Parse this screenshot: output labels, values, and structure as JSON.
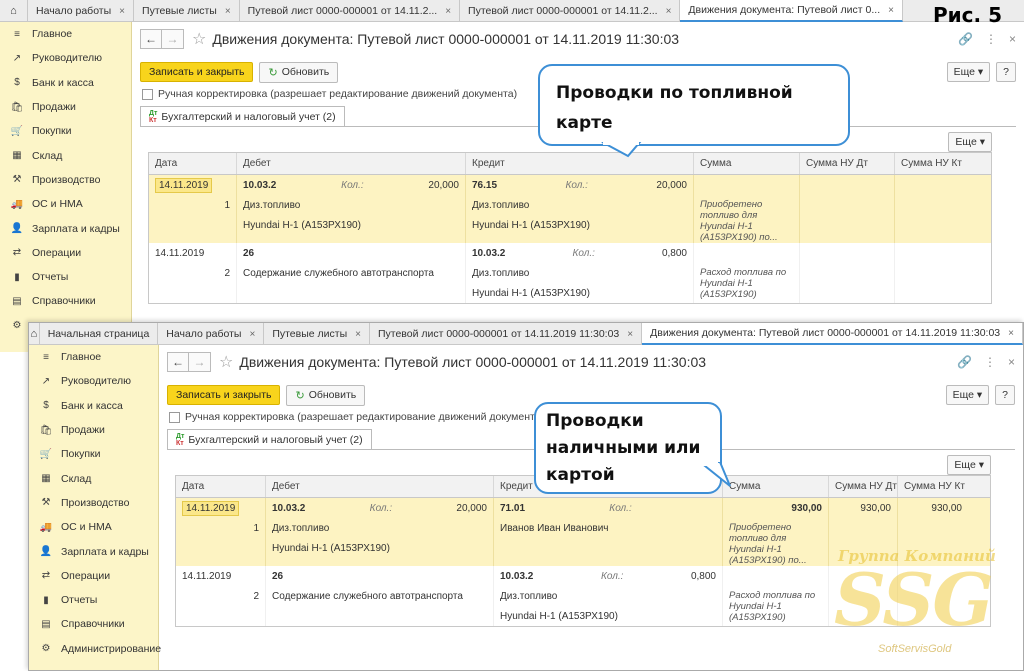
{
  "figure_label": "Рис. 5",
  "callout_top": "Проводки по топливной карте",
  "callout_bottom": "Проводки наличными или картой",
  "watermark": {
    "line1": "Группа Компаний",
    "line2": "SSG",
    "line3": "SoftServisGold"
  },
  "panel1": {
    "tabs": [
      {
        "label": "Начало работы",
        "closable": true
      },
      {
        "label": "Путевые листы",
        "closable": true
      },
      {
        "label": "Путевой лист 0000-000001 от 14.11.2...",
        "closable": true
      },
      {
        "label": "Путевой лист 0000-000001 от 14.11.2...",
        "closable": true
      },
      {
        "label": "Движения документа: Путевой лист 0...",
        "closable": true,
        "active": true
      }
    ],
    "sidebar": [
      "Главное",
      "Руководителю",
      "Банк и касса",
      "Продажи",
      "Покупки",
      "Склад",
      "Производство",
      "ОС и НМА",
      "Зарплата и кадры",
      "Операции",
      "Отчеты",
      "Справочники"
    ],
    "title": "Движения документа: Путевой лист 0000-000001 от 14.11.2019 11:30:03",
    "rows": [
      {
        "highlight": true,
        "date": "14.11.2019",
        "num": "1",
        "debet": "10.03.2",
        "debet_kol": "20,000",
        "debet_sub1": "Диз.топливо",
        "debet_sub2": "Hyundai H-1 (А153РХ190)",
        "kredit": "76.15",
        "kredit_kol": "20,000",
        "kredit_sub1": "Диз.топливо",
        "kredit_sub2": "Hyundai H-1 (А153РХ190)",
        "summa": "",
        "summa_text": "Приобретено топливо для Hyundai H-1 (А153РХ190) по...",
        "nu_dt": "",
        "nu_kt": ""
      },
      {
        "highlight": false,
        "date": "14.11.2019",
        "num": "2",
        "debet": "26",
        "debet_kol": "",
        "debet_sub1": "Содержание служебного автотранспорта",
        "debet_sub2": "",
        "kredit": "10.03.2",
        "kredit_kol": "0,800",
        "kredit_sub1": "Диз.топливо",
        "kredit_sub2": "Hyundai H-1 (А153РХ190)",
        "summa": "",
        "summa_text": "Расход топлива по Hyundai H-1 (А153РХ190)",
        "nu_dt": "",
        "nu_kt": ""
      }
    ]
  },
  "panel2": {
    "tabs": [
      {
        "label": "Начальная страница",
        "closable": false
      },
      {
        "label": "Начало работы",
        "closable": true
      },
      {
        "label": "Путевые листы",
        "closable": true
      },
      {
        "label": "Путевой лист 0000-000001 от 14.11.2019 11:30:03",
        "closable": true
      },
      {
        "label": "Движения документа: Путевой лист 0000-000001 от 14.11.2019 11:30:03",
        "closable": true,
        "active": true
      }
    ],
    "sidebar": [
      "Главное",
      "Руководителю",
      "Банк и касса",
      "Продажи",
      "Покупки",
      "Склад",
      "Производство",
      "ОС и НМА",
      "Зарплата и кадры",
      "Операции",
      "Отчеты",
      "Справочники",
      "Администрирование"
    ],
    "title": "Движения документа: Путевой лист 0000-000001 от 14.11.2019 11:30:03",
    "rows": [
      {
        "highlight": true,
        "date": "14.11.2019",
        "num": "1",
        "debet": "10.03.2",
        "debet_kol": "20,000",
        "debet_sub1": "Диз.топливо",
        "debet_sub2": "Hyundai H-1 (А153РХ190)",
        "kredit": "71.01",
        "kredit_kol": "",
        "kredit_sub1": "Иванов Иван Иванович",
        "kredit_sub2": "",
        "summa": "930,00",
        "summa_text": "Приобретено топливо для Hyundai H-1 (А153РХ190) по...",
        "nu_dt": "930,00",
        "nu_kt": "930,00"
      },
      {
        "highlight": false,
        "date": "14.11.2019",
        "num": "2",
        "debet": "26",
        "debet_kol": "",
        "debet_sub1": "Содержание служебного автотранспорта",
        "debet_sub2": "",
        "kredit": "10.03.2",
        "kredit_kol": "0,800",
        "kredit_sub1": "Диз.топливо",
        "kredit_sub2": "Hyundai H-1 (А153РХ190)",
        "summa": "",
        "summa_text": "Расход топлива по Hyundai H-1 (А153РХ190)",
        "nu_dt": "",
        "nu_kt": ""
      }
    ]
  },
  "common": {
    "save_label": "Записать и закрыть",
    "refresh_label": "Обновить",
    "more_label": "Еще",
    "help_label": "?",
    "checkbox_label": "Ручная корректировка (разрешает редактирование движений документа)",
    "doc_tab_label": "Бухгалтерский и налоговый учет (2)",
    "doc_tab_icon_dt": "Дт",
    "doc_tab_icon_kt": "Кт",
    "kol_label": "Кол.:",
    "columns": {
      "date": "Дата",
      "debet": "Дебет",
      "kredit": "Кредит",
      "summa": "Сумма",
      "nu_dt": "Сумма НУ Дт",
      "nu_kt": "Сумма НУ Кт"
    }
  }
}
